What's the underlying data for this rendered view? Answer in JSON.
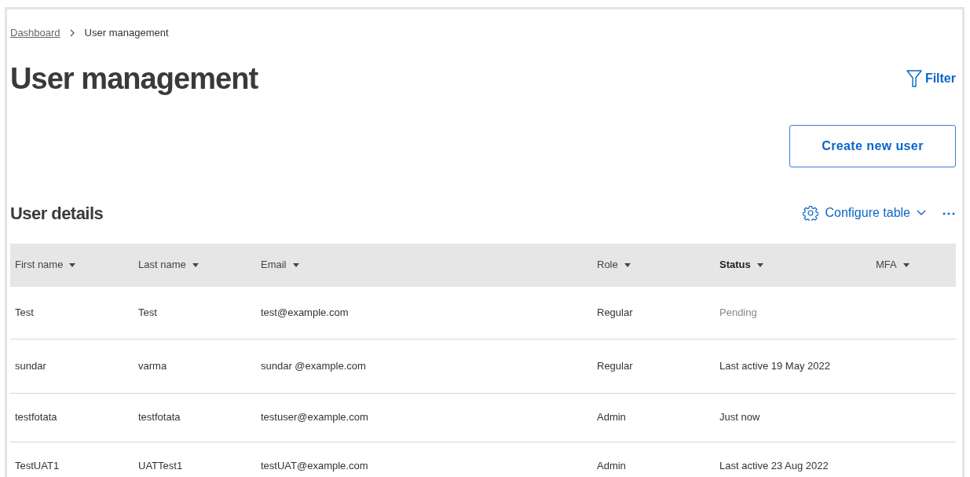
{
  "breadcrumb": [
    {
      "label": "Dashboard",
      "link": true
    },
    {
      "label": "User management",
      "link": false
    }
  ],
  "title": "User management",
  "filter_button": "Filter",
  "create_button": "Create new user",
  "section_title": "User details",
  "configure_button": "Configure table",
  "more_button": "⋯",
  "table": {
    "columns": [
      {
        "label": "First name",
        "sorted": false
      },
      {
        "label": "Last name",
        "sorted": false
      },
      {
        "label": "Email",
        "sorted": false
      },
      {
        "label": "Role",
        "sorted": false
      },
      {
        "label": "Status",
        "sorted": true
      },
      {
        "label": "MFA",
        "sorted": false
      }
    ],
    "rows": [
      {
        "first_name": "Test",
        "last_name": "Test",
        "email": "test@example.com",
        "role": "Regular",
        "status": "Pending",
        "pending": true
      },
      {
        "first_name": "sundar",
        "last_name": "varma",
        "email": "sundar @example.com",
        "role": "Regular",
        "status": "Last active 19 May 2022",
        "pending": false
      },
      {
        "first_name": "testfotata",
        "last_name": "testfotata",
        "email": "testuser@example.com",
        "role": "Admin",
        "status": "Just now",
        "pending": false
      },
      {
        "first_name": "TestUAT1",
        "last_name": "UATTest1",
        "email": "testUAT@example.com",
        "role": "Admin",
        "status": "Last active 23 Aug 2022",
        "pending": false
      }
    ]
  }
}
